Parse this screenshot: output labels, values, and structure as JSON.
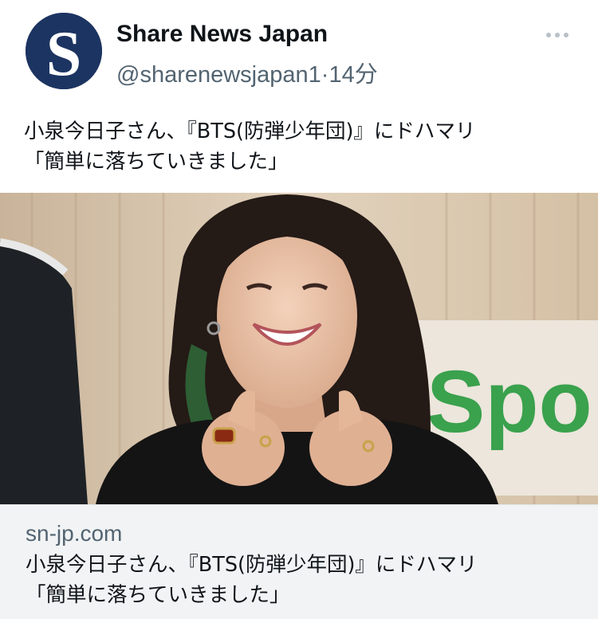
{
  "post": {
    "author": {
      "display_name": "Share News Japan",
      "handle": "@sharenewsjapan1",
      "separator": "·",
      "time": "14分",
      "avatar_letter": "S",
      "avatar_color": "#1c3461"
    },
    "text_lines": [
      "小泉今日子さん、『BTS(防弾少年団)』にドハマリ",
      "「簡単に落ちていきました」"
    ],
    "more_icon": "more-horizontal-icon"
  },
  "link_card": {
    "image_alt": "Woman smiling and making finger hearts with both hands",
    "image_sign_text": "Spo",
    "domain": "sn-jp.com",
    "title_lines": [
      "小泉今日子さん、『BTS(防弾少年団)』にドハマリ",
      "「簡単に落ちていきました」"
    ]
  },
  "colors": {
    "text_primary": "#0f1419",
    "text_secondary": "#536471",
    "card_background": "#f1f3f4",
    "brand_green": "#3aa14d"
  }
}
